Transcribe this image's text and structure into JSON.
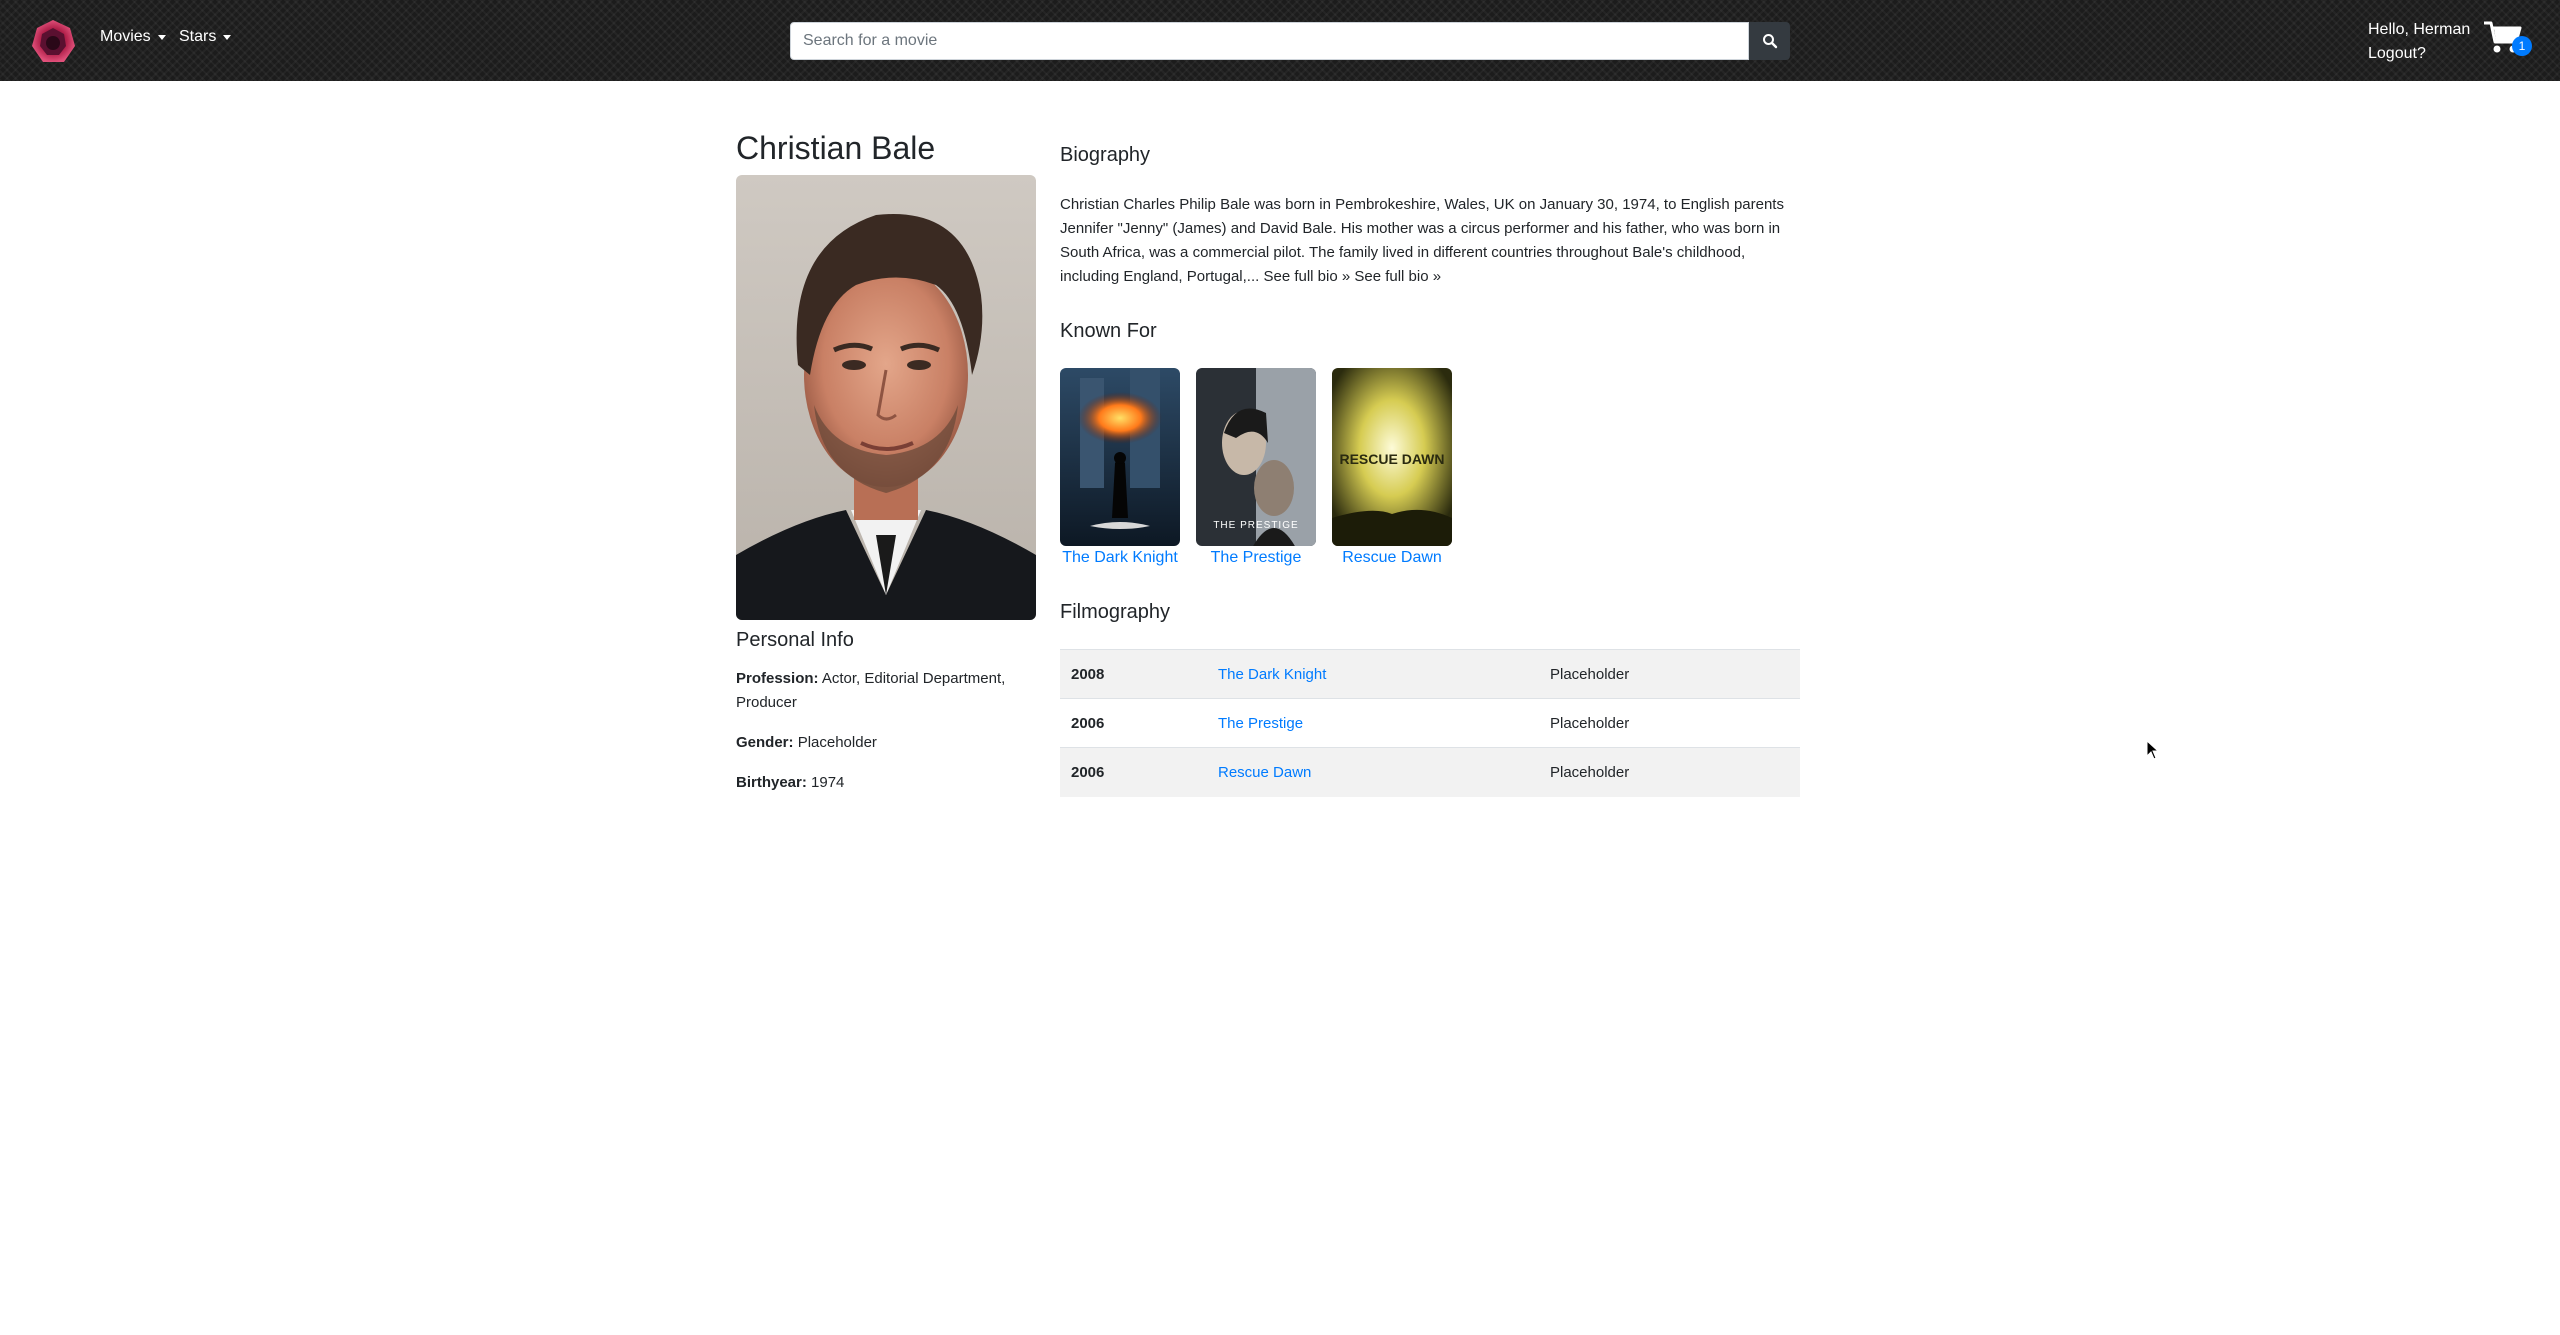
{
  "nav": {
    "movies_label": "Movies",
    "stars_label": "Stars",
    "search_placeholder": "Search for a movie",
    "greeting": "Hello, Herman",
    "logout_label": "Logout?",
    "cart_count": "1",
    "colors": {
      "accent": "#007bff",
      "search_button": "#343a40"
    }
  },
  "star": {
    "name": "Christian Bale",
    "personal_info_heading": "Personal Info",
    "profession_label": "Profession:",
    "profession_value": "Actor, Editorial Department, Producer",
    "gender_label": "Gender:",
    "gender_value": "Placeholder",
    "birthyear_label": "Birthyear:",
    "birthyear_value": "1974"
  },
  "biography": {
    "heading": "Biography",
    "text": "Christian Charles Philip Bale was born in Pembrokeshire, Wales, UK on January 30, 1974, to English parents Jennifer \"Jenny\" (James) and David Bale. His mother was a circus performer and his father, who was born in South Africa, was a commercial pilot. The family lived in different countries throughout Bale's childhood, including England, Portugal,... See full bio » See full bio »"
  },
  "known_for": {
    "heading": "Known For",
    "items": [
      {
        "title": "The Dark Knight",
        "poster_text": ""
      },
      {
        "title": "The Prestige",
        "poster_text": "THE PRESTIGE"
      },
      {
        "title": "Rescue Dawn",
        "poster_text": "RESCUE DAWN"
      }
    ]
  },
  "filmography": {
    "heading": "Filmography",
    "rows": [
      {
        "year": "2008",
        "title": "The Dark Knight",
        "role": "Placeholder"
      },
      {
        "year": "2006",
        "title": "The Prestige",
        "role": "Placeholder"
      },
      {
        "year": "2006",
        "title": "Rescue Dawn",
        "role": "Placeholder"
      }
    ]
  }
}
